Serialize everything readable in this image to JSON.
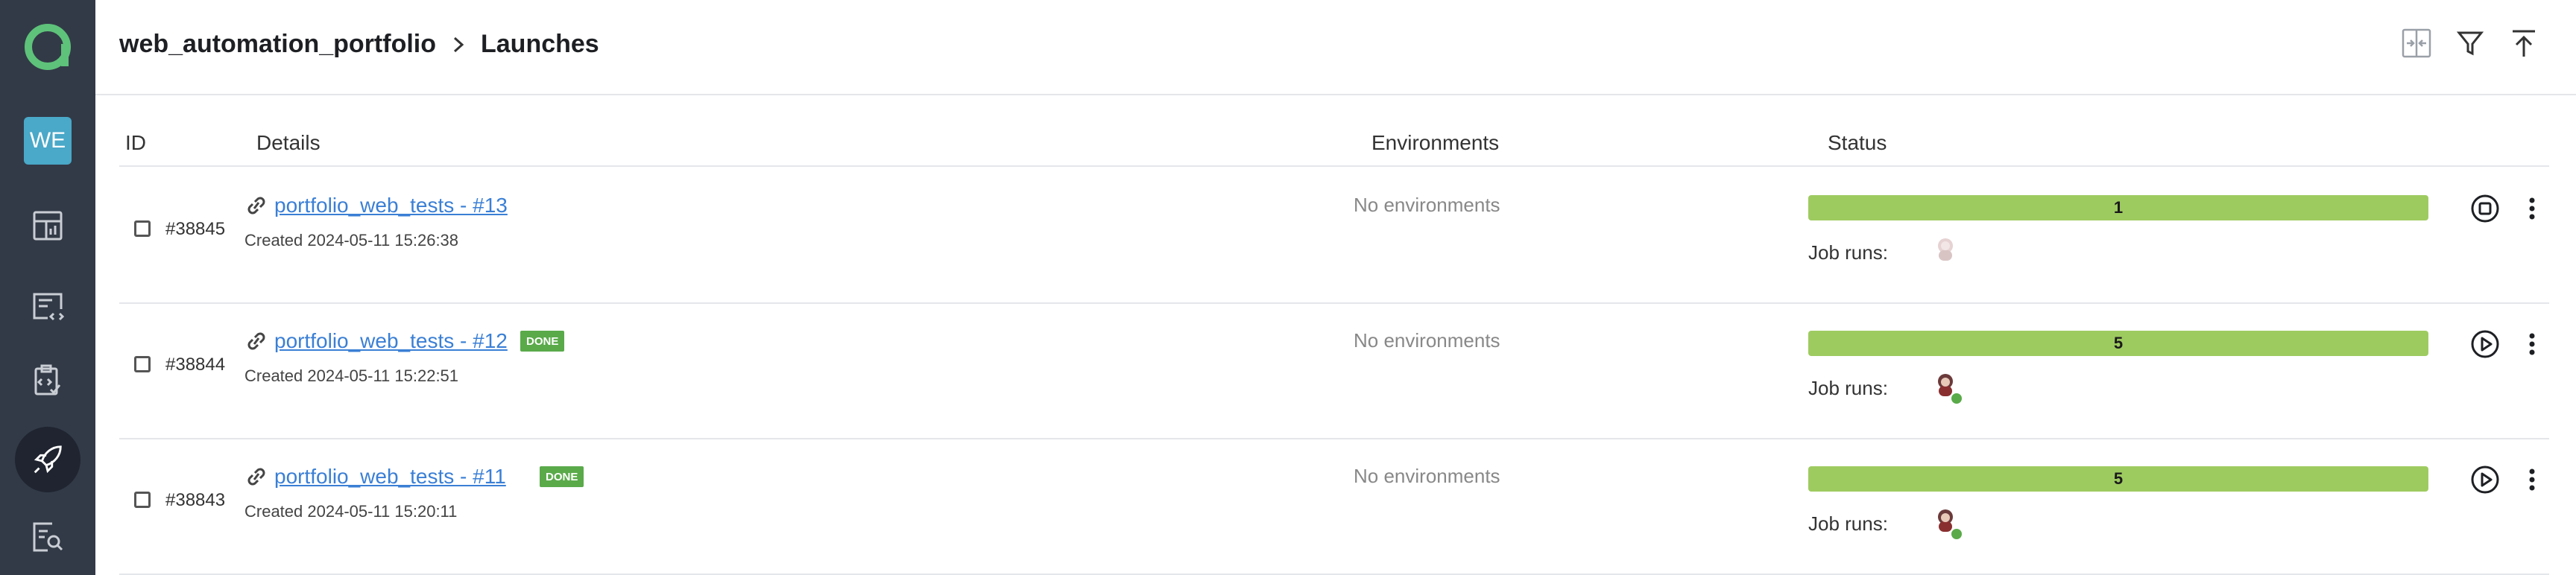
{
  "sidebar": {
    "workspace_badge": "WE",
    "items": [
      {
        "icon": "dashboard-icon"
      },
      {
        "icon": "code-file-icon"
      },
      {
        "icon": "clipboard-check-icon"
      },
      {
        "icon": "rocket-icon",
        "active": true
      },
      {
        "icon": "search-report-icon"
      }
    ]
  },
  "header": {
    "breadcrumb_project": "web_automation_portfolio",
    "breadcrumb_page": "Launches"
  },
  "table": {
    "columns": {
      "id": "ID",
      "details": "Details",
      "environments": "Environments",
      "status": "Status"
    },
    "rows": [
      {
        "id": "#38845",
        "name": "portfolio_web_tests - #13",
        "badge": "",
        "created": "Created 2024-05-11 15:26:38",
        "environments": "No environments",
        "count": "1",
        "job_runs_label": "Job runs:",
        "action": "stop",
        "online": false
      },
      {
        "id": "#38844",
        "name": "portfolio_web_tests - #12",
        "badge": "DONE",
        "created": "Created 2024-05-11 15:22:51",
        "environments": "No environments",
        "count": "5",
        "job_runs_label": "Job runs:",
        "action": "play",
        "online": true
      },
      {
        "id": "#38843",
        "name": "portfolio_web_tests - #11",
        "badge": "DONE",
        "created": "Created 2024-05-11 15:20:11",
        "environments": "No environments",
        "count": "5",
        "job_runs_label": "Job runs:",
        "action": "play",
        "online": true
      }
    ]
  },
  "colors": {
    "sidebar": "#323a47",
    "accent_green": "#5aaa4a",
    "progress": "#9ecb60",
    "link": "#3a7fd5"
  }
}
